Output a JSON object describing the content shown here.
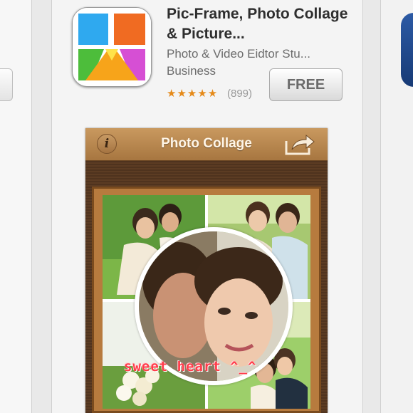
{
  "app": {
    "name": "Pic-Frame, Photo Collage & Picture...",
    "developer": "Photo & Video Eidtor Stu...",
    "category": "Business",
    "rating_stars": "★★★★★",
    "rating_value": 4.5,
    "rating_count": "(899)",
    "price_button": "FREE",
    "icon_name": "collage-app-icon"
  },
  "preview": {
    "toolbar_title": "Photo Collage",
    "info_label": "i",
    "share_icon": "share-arrow-icon",
    "caption": "sweet heart ^_^"
  },
  "colors": {
    "accent_rating": "#e58a1a",
    "toolbar": "#b8874f",
    "caption": "#ff3c4a"
  }
}
